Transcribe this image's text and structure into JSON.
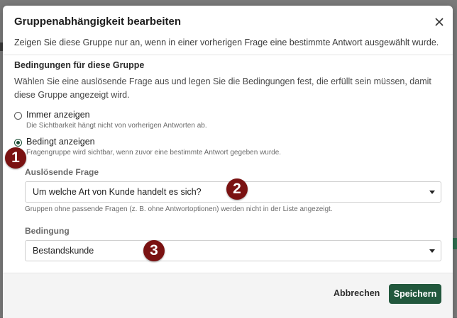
{
  "dialog": {
    "title": "Gruppenabhängigkeit bearbeiten",
    "subtitle": "Zeigen Sie diese Gruppe nur an, wenn in einer vorherigen Frage eine bestimmte Antwort ausgewählt wurde.",
    "close_icon": "close-icon"
  },
  "conditions": {
    "title": "Bedingungen für diese Gruppe",
    "description": "Wählen Sie eine auslösende Frage aus und legen Sie die Bedingungen fest, die erfüllt sein müssen, damit diese Gruppe angezeigt wird."
  },
  "visibility": {
    "selected": "conditional",
    "always": {
      "label": "Immer anzeigen",
      "hint": "Die Sichtbarkeit hängt nicht von vorherigen Antworten ab."
    },
    "conditional": {
      "label": "Bedingt anzeigen",
      "hint": "Fragengruppe wird sichtbar, wenn zuvor eine bestimmte Antwort gegeben wurde."
    }
  },
  "trigger_question": {
    "label": "Auslösende Frage",
    "value": "Um welche Art von Kunde handelt es sich?",
    "hint": "Gruppen ohne passende Fragen (z. B. ohne Antwortoptionen) werden nicht in der Liste angezeigt."
  },
  "condition": {
    "label": "Bedingung",
    "value": "Bestandskunde"
  },
  "footer": {
    "cancel_label": "Abbrechen",
    "save_label": "Speichern"
  },
  "markers": [
    "1",
    "2",
    "3"
  ],
  "colors": {
    "primary": "#22583d",
    "marker": "#7a1212"
  }
}
